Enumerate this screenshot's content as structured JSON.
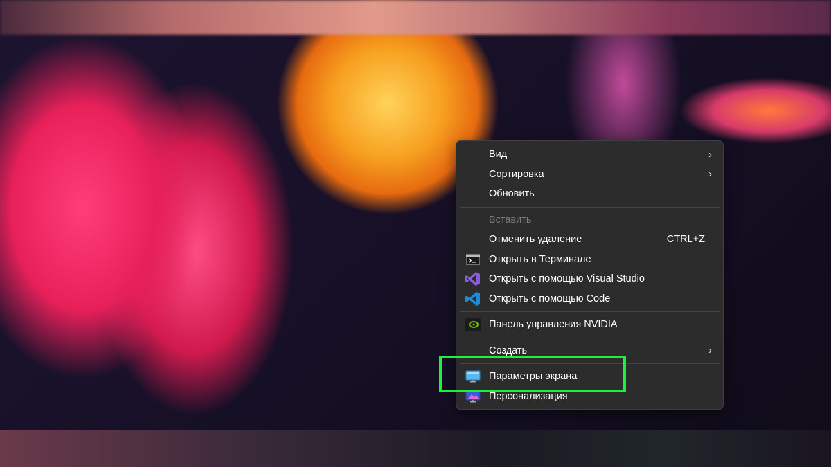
{
  "menu": {
    "items": [
      {
        "label": "Вид",
        "submenu": true
      },
      {
        "label": "Сортировка",
        "submenu": true
      },
      {
        "label": "Обновить"
      },
      {
        "label": "Вставить",
        "disabled": true
      },
      {
        "label": "Отменить удаление",
        "shortcut": "CTRL+Z"
      },
      {
        "label": "Открыть в Терминале",
        "icon": "terminal-icon"
      },
      {
        "label": "Открыть с помощью Visual Studio",
        "icon": "visual-studio-icon"
      },
      {
        "label": "Открыть с помощью Code",
        "icon": "vscode-icon"
      },
      {
        "label": "Панель управления NVIDIA",
        "icon": "nvidia-icon"
      },
      {
        "label": "Создать",
        "submenu": true
      },
      {
        "label": "Параметры экрана",
        "icon": "display-icon",
        "highlighted": true
      },
      {
        "label": "Персонализация",
        "icon": "personalization-icon"
      }
    ],
    "chevron": "›",
    "highlight_color": "#1ff03a"
  }
}
